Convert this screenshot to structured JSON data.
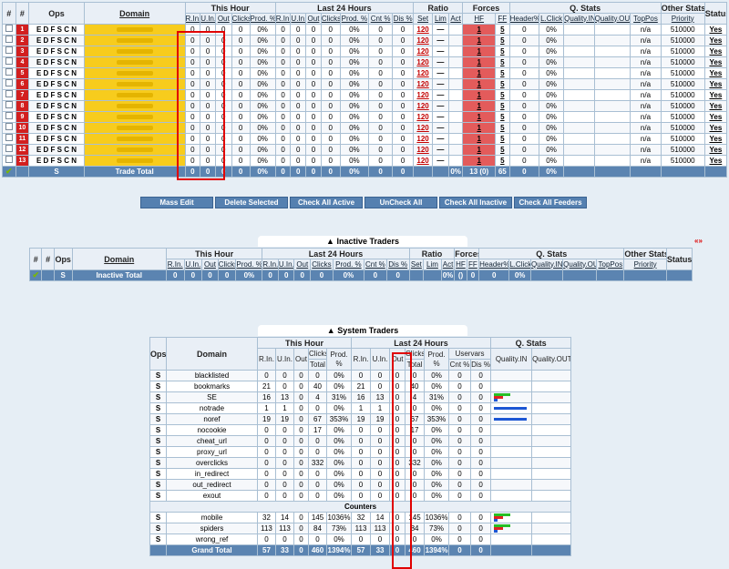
{
  "active": {
    "groups": {
      "num": "#",
      "ops": "Ops",
      "domain": "Domain",
      "this_hour": "This Hour",
      "last24": "Last 24 Hours",
      "ratio": "Ratio",
      "forces": "Forces",
      "qstats": "Q. Stats",
      "other": "Other Stats",
      "status": "Status"
    },
    "sub": {
      "rin": "R.In.",
      "uin": "U.In.",
      "out": "Out",
      "clicks": "Clicks",
      "total": "Total",
      "prod": "Prod. %",
      "uservars": "Uservars",
      "cnt": "Cnt %",
      "dis": "Dis %",
      "set": "Set",
      "lim": "Lim",
      "act": "Act",
      "hf": "HF",
      "ff": "FF",
      "header": "Header%",
      "lclick": "L.Click",
      "qin": "Quality.IN",
      "qout": "Quality.OUT",
      "toppos": "TopPos",
      "priority": "Priority"
    },
    "ops_letters": "E D F S C N",
    "row_values": {
      "zero": "0",
      "pct": "0%",
      "set": "120",
      "lim": "—",
      "hf": "1",
      "ff": "5",
      "na": "n/a",
      "priority": "510000",
      "status": "Yes"
    },
    "rows": [
      "1",
      "2",
      "3",
      "4",
      "5",
      "6",
      "7",
      "8",
      "9",
      "10",
      "11",
      "12",
      "13"
    ],
    "total": {
      "ops": "S",
      "label": "Trade Total",
      "zero": "0",
      "pct": "0%",
      "hf": "13 (0)",
      "ff": "65",
      "qpct": "0%"
    }
  },
  "buttons": [
    "Mass Edit",
    "Delete Selected",
    "Check All Active",
    "UnCheck All",
    "Check All Inactive",
    "Check All Feeders"
  ],
  "inactive": {
    "title": "Inactive Traders",
    "collapse_icon": "«»",
    "total": {
      "ops": "S",
      "label": "Inactive Total",
      "zero": "0",
      "pct": "0%",
      "hf": "()",
      "ff": "0",
      "qpct": "0%"
    }
  },
  "system": {
    "title": "System Traders",
    "cols": {
      "ops": "Ops",
      "domain": "Domain",
      "this_hour": "This Hour",
      "last24": "Last 24 Hours",
      "qstats": "Q. Stats",
      "rin": "R.In.",
      "uin": "U.In.",
      "out": "Out",
      "clicks": "Clicks",
      "total": "Total",
      "prod": "Prod. %",
      "uservars": "Uservars",
      "cnt": "Cnt %",
      "dis": "Dis %",
      "qin": "Quality.IN",
      "qout": "Quality.OUT"
    },
    "rows": [
      {
        "ops": "S",
        "name": "blacklisted",
        "v": [
          "0",
          "0",
          "0",
          "0",
          "0%",
          "0",
          "0",
          "0",
          "0",
          "0%",
          "0",
          "0"
        ]
      },
      {
        "ops": "S",
        "name": "bookmarks",
        "v": [
          "21",
          "0",
          "0",
          "40",
          "0%",
          "21",
          "0",
          "0",
          "40",
          "0%",
          "0",
          "0"
        ]
      },
      {
        "ops": "S",
        "name": "SE",
        "v": [
          "16",
          "13",
          "0",
          "4",
          "31%",
          "16",
          "13",
          "0",
          "4",
          "31%",
          "0",
          "0"
        ],
        "bars": "se"
      },
      {
        "ops": "S",
        "name": "notrade",
        "v": [
          "1",
          "1",
          "0",
          "0",
          "0%",
          "1",
          "1",
          "0",
          "0",
          "0%",
          "0",
          "0"
        ],
        "bars": "blue"
      },
      {
        "ops": "S",
        "name": "noref",
        "v": [
          "19",
          "19",
          "0",
          "67",
          "353%",
          "19",
          "19",
          "0",
          "67",
          "353%",
          "0",
          "0"
        ],
        "bars": "blue"
      },
      {
        "ops": "S",
        "name": "nocookie",
        "v": [
          "0",
          "0",
          "0",
          "17",
          "0%",
          "0",
          "0",
          "0",
          "17",
          "0%",
          "0",
          "0"
        ]
      },
      {
        "ops": "S",
        "name": "cheat_url",
        "v": [
          "0",
          "0",
          "0",
          "0",
          "0%",
          "0",
          "0",
          "0",
          "0",
          "0%",
          "0",
          "0"
        ]
      },
      {
        "ops": "S",
        "name": "proxy_url",
        "v": [
          "0",
          "0",
          "0",
          "0",
          "0%",
          "0",
          "0",
          "0",
          "0",
          "0%",
          "0",
          "0"
        ]
      },
      {
        "ops": "S",
        "name": "overclicks",
        "v": [
          "0",
          "0",
          "0",
          "332",
          "0%",
          "0",
          "0",
          "0",
          "332",
          "0%",
          "0",
          "0"
        ]
      },
      {
        "ops": "S",
        "name": "in_redirect",
        "v": [
          "0",
          "0",
          "0",
          "0",
          "0%",
          "0",
          "0",
          "0",
          "0",
          "0%",
          "0",
          "0"
        ]
      },
      {
        "ops": "S",
        "name": "out_redirect",
        "v": [
          "0",
          "0",
          "0",
          "0",
          "0%",
          "0",
          "0",
          "0",
          "0",
          "0%",
          "0",
          "0"
        ]
      },
      {
        "ops": "S",
        "name": "exout",
        "v": [
          "0",
          "0",
          "0",
          "0",
          "0%",
          "0",
          "0",
          "0",
          "0",
          "0%",
          "0",
          "0"
        ]
      }
    ],
    "counters_label": "Counters",
    "counters": [
      {
        "ops": "S",
        "name": "mobile",
        "v": [
          "32",
          "14",
          "0",
          "145",
          "1036%",
          "32",
          "14",
          "0",
          "145",
          "1036%",
          "0",
          "0"
        ],
        "bars": "se"
      },
      {
        "ops": "S",
        "name": "spiders",
        "v": [
          "113",
          "113",
          "0",
          "84",
          "73%",
          "113",
          "113",
          "0",
          "84",
          "73%",
          "0",
          "0"
        ],
        "bars": "se"
      },
      {
        "ops": "S",
        "name": "wrong_ref",
        "v": [
          "0",
          "0",
          "0",
          "0",
          "0%",
          "0",
          "0",
          "0",
          "0",
          "0%",
          "0",
          "0"
        ]
      }
    ],
    "grand": {
      "label": "Grand Total",
      "v": [
        "57",
        "33",
        "0",
        "460",
        "1394%",
        "57",
        "33",
        "0",
        "460",
        "1394%",
        "0",
        "0"
      ]
    }
  }
}
